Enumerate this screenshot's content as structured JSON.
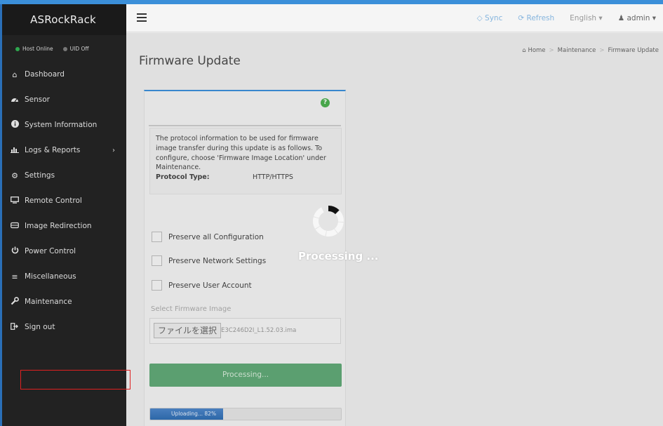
{
  "sidebar": {
    "brand": "ASRockRack",
    "status": {
      "host": "Host Online",
      "uid": "UID Off",
      "host_color": "#2fa84f",
      "uid_color": "#777777"
    },
    "items": [
      {
        "label": "Dashboard",
        "icon": "home-icon"
      },
      {
        "label": "Sensor",
        "icon": "dashboard-gauge-icon"
      },
      {
        "label": "System Information",
        "icon": "info-icon"
      },
      {
        "label": "Logs & Reports",
        "icon": "bar-chart-icon"
      },
      {
        "label": "Settings",
        "icon": "gear-icon"
      },
      {
        "label": "Remote Control",
        "icon": "monitor-icon"
      },
      {
        "label": "Image Redirection",
        "icon": "drive-icon"
      },
      {
        "label": "Power Control",
        "icon": "power-icon"
      },
      {
        "label": "Miscellaneous",
        "icon": "menu-lines-icon"
      },
      {
        "label": "Maintenance",
        "icon": "wrench-icon"
      },
      {
        "label": "Sign out",
        "icon": "sign-out-icon"
      }
    ]
  },
  "header": {
    "sync": "Sync",
    "refresh": "Refresh",
    "language": "English",
    "user": "admin"
  },
  "page": {
    "title": "Firmware Update",
    "breadcrumb": [
      "Home",
      "Maintenance",
      "Firmware Update"
    ]
  },
  "panel": {
    "info_text": "The protocol information to be used for firmware image transfer during this update is as follows. To configure, choose 'Firmware Image Location' under Maintenance.",
    "protocol_label": "Protocol Type:",
    "protocol_value": "HTTP/HTTPS",
    "checkboxes": [
      "Preserve all Configuration",
      "Preserve Network Settings",
      "Preserve User Account"
    ],
    "select_label": "Select Firmware Image",
    "file_button": "ファイルを選択",
    "file_name": "E3C246D2I_L1.52.03.ima",
    "process_button": "Processing...",
    "progress_text": "Uploading... 82%",
    "progress_percent": 82
  },
  "overlay": {
    "text": "Processing ..."
  },
  "colors": {
    "accent": "#3b8fd9",
    "sidebar_bg": "#222222",
    "success": "#60a876",
    "progress": "#2f6db2",
    "highlight": "#e02020"
  }
}
